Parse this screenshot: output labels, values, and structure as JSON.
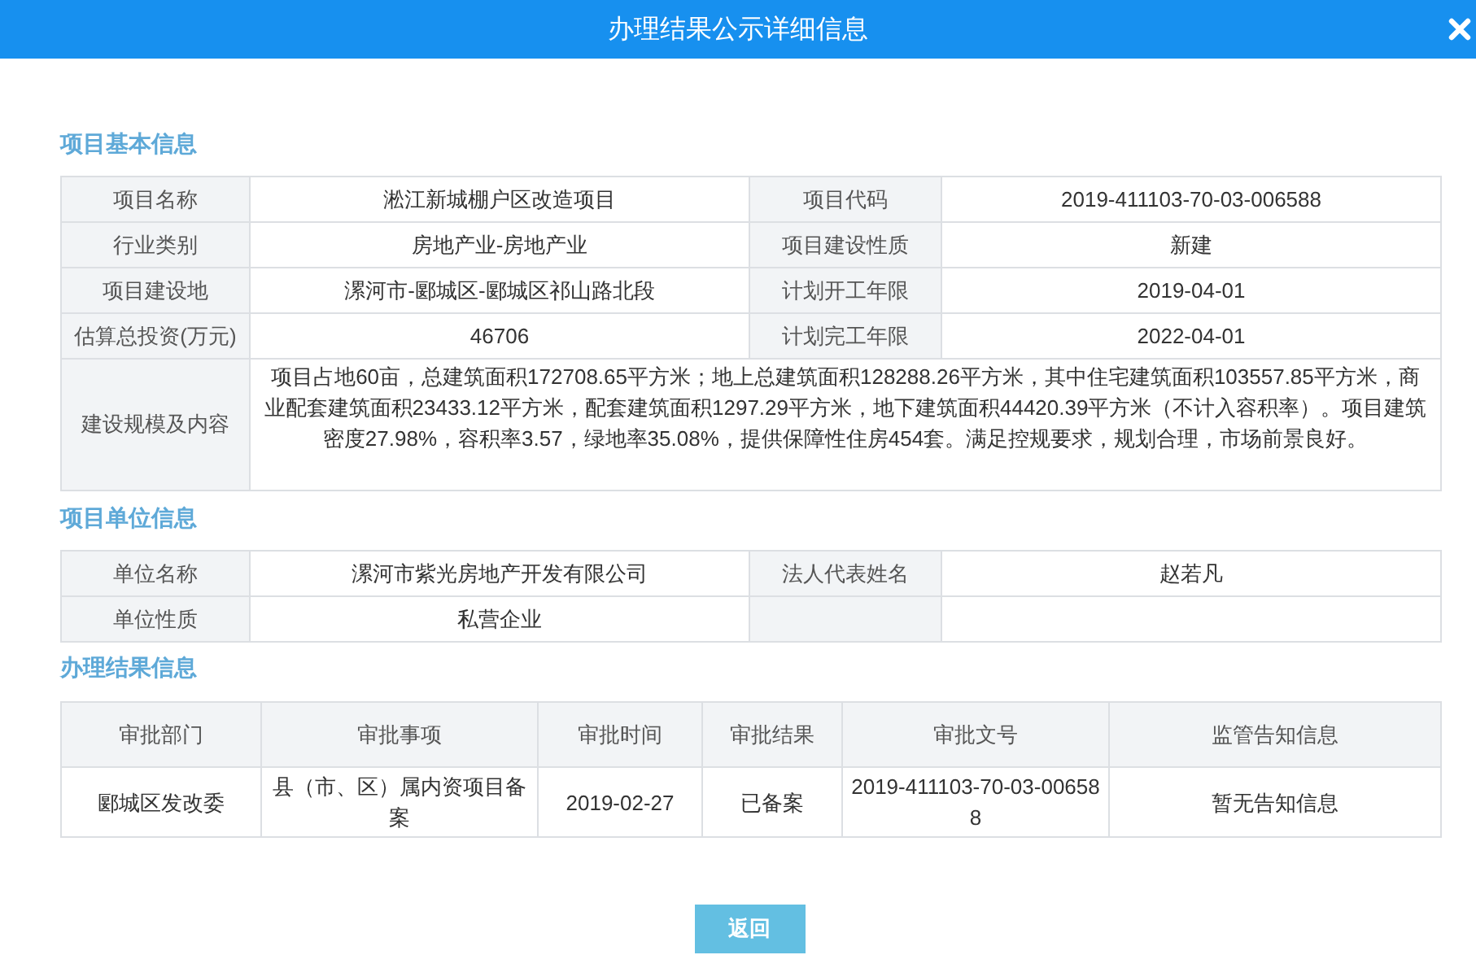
{
  "dialog": {
    "title": "办理结果公示详细信息"
  },
  "basic_info": {
    "title": "项目基本信息",
    "fields": [
      {
        "kind": "pair",
        "label": "项目名称",
        "value": "淞江新城棚户区改造项目"
      },
      {
        "kind": "pair",
        "label": "项目代码",
        "value": "2019-411103-70-03-006588"
      },
      {
        "kind": "pair",
        "label": "行业类别",
        "value": "房地产业-房地产业"
      },
      {
        "kind": "pair",
        "label": "项目建设性质",
        "value": "新建"
      },
      {
        "kind": "pair",
        "label": "项目建设地",
        "value": "漯河市-郾城区-郾城区祁山路北段"
      },
      {
        "kind": "pair",
        "label": "计划开工年限",
        "value": "2019-04-01"
      },
      {
        "kind": "pair",
        "label": "估算总投资(万元)",
        "value": "46706"
      },
      {
        "kind": "pair",
        "label": "计划完工年限",
        "value": "2022-04-01"
      },
      {
        "kind": "wide",
        "label": "建设规模及内容",
        "value": "项目占地60亩，总建筑面积172708.65平方米；地上总建筑面积128288.26平方米，其中住宅建筑面积103557.85平方米，商业配套建筑面积23433.12平方米，配套建筑面积1297.29平方米，地下建筑面积44420.39平方米（不计入容积率）。项目建筑密度27.98%，容积率3.57，绿地率35.08%，提供保障性住房454套。满足控规要求，规划合理，市场前景良好。"
      }
    ]
  },
  "unit_info": {
    "title": "项目单位信息",
    "fields": [
      {
        "kind": "pair",
        "label": "单位名称",
        "value": "漯河市紫光房地产开发有限公司"
      },
      {
        "kind": "pair",
        "label": "法人代表姓名",
        "value": "赵若凡"
      },
      {
        "kind": "pair",
        "label": "单位性质",
        "value": "私营企业"
      }
    ]
  },
  "result_info": {
    "title": "办理结果信息",
    "columns": [
      "审批部门",
      "审批事项",
      "审批时间",
      "审批结果",
      "审批文号",
      "监管告知信息"
    ],
    "rows": [
      [
        "郾城区发改委",
        "县（市、区）属内资项目备案",
        "2019-02-27",
        "已备案",
        "2019-411103-70-03-006588",
        "暂无告知信息"
      ]
    ]
  },
  "buttons": [
    "返回"
  ]
}
